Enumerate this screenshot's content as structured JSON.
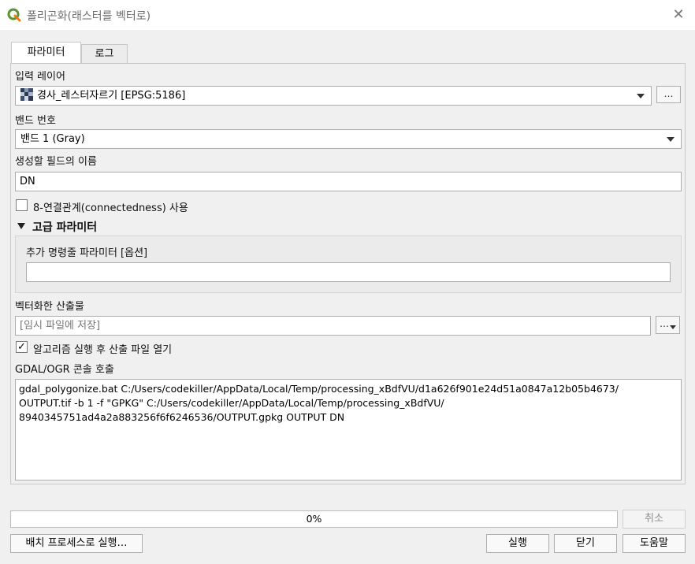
{
  "window": {
    "title": "폴리곤화(래스터를 벡터로)",
    "close_glyph": "✕"
  },
  "tabs": [
    {
      "label": "파라미터"
    },
    {
      "label": "로그"
    }
  ],
  "params": {
    "input_layer_label": "입력 레이어",
    "input_layer_value": "경사_레스터자르기 [EPSG:5186]",
    "input_layer_icon": "raster-layer-icon",
    "band_label": "밴드 번호",
    "band_value": "밴드 1 (Gray)",
    "field_label": "생성할 필드의 이름",
    "field_value": "DN",
    "connectedness_label": "8-연결관계(connectedness) 사용",
    "connectedness_checked": false,
    "advanced_label": "고급 파라미터",
    "extra_params_label": "추가 명령줄 파라미터 [옵션]",
    "extra_params_value": "",
    "output_label": "벡터화한 산출물",
    "output_placeholder": "[임시 파일에 저장]",
    "open_output_label": "알고리즘 실행 후 산출 파일 열기",
    "open_output_checked": true,
    "console_label": "GDAL/OGR 콘솔 호출",
    "console_text": "gdal_polygonize.bat C:/Users/codekiller/AppData/Local/Temp/processing_xBdfVU/d1a626f901e24d51a0847a12b05b4673/\nOUTPUT.tif -b 1 -f \"GPKG\" C:/Users/codekiller/AppData/Local/Temp/processing_xBdfVU/\n8940345751ad4a2a883256f6f6246536/OUTPUT.gpkg OUTPUT DN",
    "dots_label": "…",
    "check_glyph": "✓"
  },
  "progress": {
    "value_text": "0%",
    "cancel_label": "취소"
  },
  "footer": {
    "batch_label": "배치 프로세스로 실행…",
    "run_label": "실행",
    "close_label": "닫기",
    "help_label": "도움말"
  },
  "colors": {
    "qgis_green": "#589632",
    "qgis_yellow": "#ee7913"
  }
}
